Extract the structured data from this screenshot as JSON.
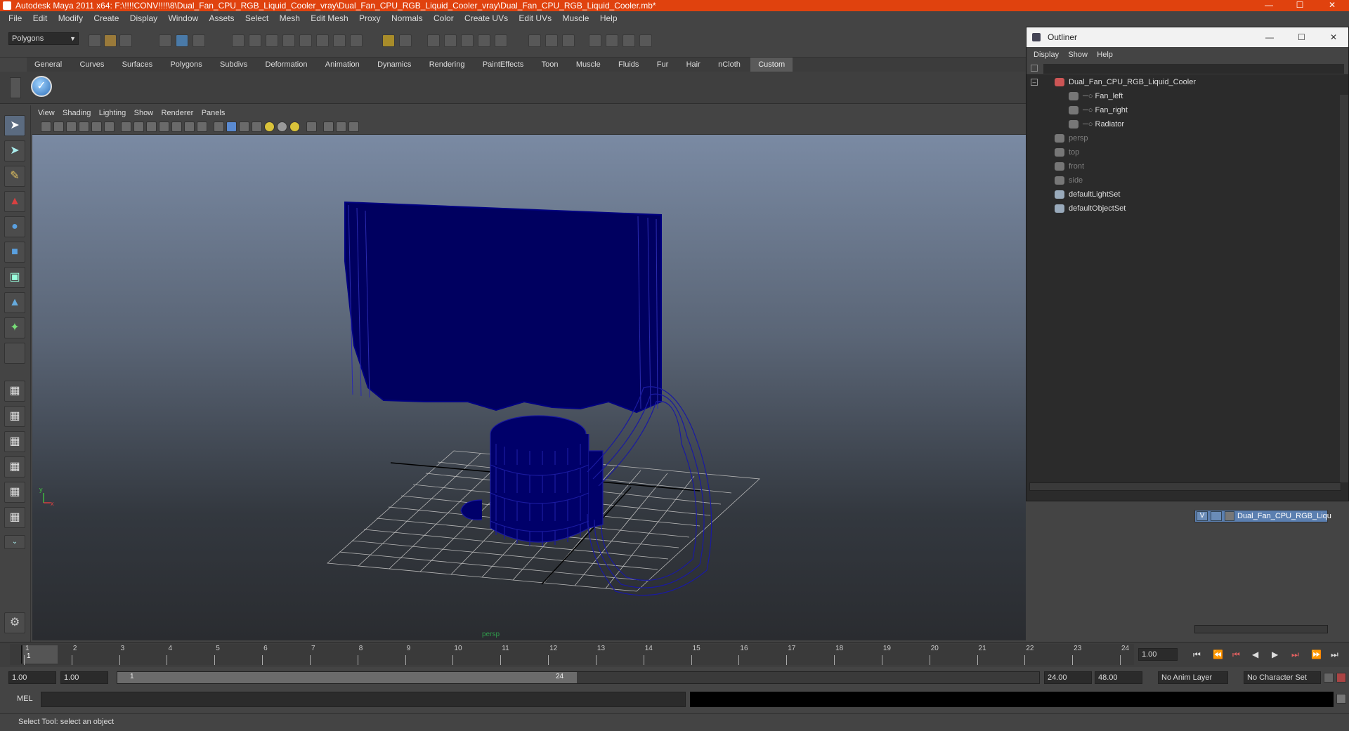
{
  "window": {
    "title": "Autodesk Maya 2011 x64: F:\\!!!!CONV!!!!\\8\\Dual_Fan_CPU_RGB_Liquid_Cooler_vray\\Dual_Fan_CPU_RGB_Liquid_Cooler_vray\\Dual_Fan_CPU_RGB_Liquid_Cooler.mb*"
  },
  "menubar": [
    "File",
    "Edit",
    "Modify",
    "Create",
    "Display",
    "Window",
    "Assets",
    "Select",
    "Mesh",
    "Edit Mesh",
    "Proxy",
    "Normals",
    "Color",
    "Create UVs",
    "Edit UVs",
    "Muscle",
    "Help"
  ],
  "statusline": {
    "mode_select": "Polygons"
  },
  "shelf": {
    "tabs": [
      "General",
      "Curves",
      "Surfaces",
      "Polygons",
      "Subdivs",
      "Deformation",
      "Animation",
      "Dynamics",
      "Rendering",
      "PaintEffects",
      "Toon",
      "Muscle",
      "Fluids",
      "Fur",
      "Hair",
      "nCloth",
      "Custom"
    ],
    "active_tab": "Custom"
  },
  "panel": {
    "menu": [
      "View",
      "Shading",
      "Lighting",
      "Show",
      "Renderer",
      "Panels"
    ],
    "camera_label": "persp"
  },
  "timeline": {
    "ticks": [
      "1",
      "2",
      "3",
      "4",
      "5",
      "6",
      "7",
      "8",
      "9",
      "10",
      "11",
      "12",
      "13",
      "14",
      "15",
      "16",
      "17",
      "18",
      "19",
      "20",
      "21",
      "22",
      "23",
      "24"
    ],
    "current_frame": "1",
    "current_time_field": "1.00"
  },
  "range": {
    "start": "1.00",
    "playback_start": "1.00",
    "slider_start": "1",
    "slider_end": "24",
    "playback_end": "24.00",
    "end": "48.00",
    "anim_layer": "No Anim Layer",
    "character_set": "No Character Set"
  },
  "command": {
    "label": "MEL"
  },
  "helpline": {
    "text": "Select Tool: select an object"
  },
  "outliner": {
    "title": "Outliner",
    "menu": [
      "Display",
      "Show",
      "Help"
    ],
    "items": [
      {
        "label": "Dual_Fan_CPU_RGB_Liquid_Cooler",
        "indent": 0,
        "dim": false,
        "icon": "transform-icon"
      },
      {
        "label": "Fan_left",
        "indent": 1,
        "dim": false,
        "icon": "mesh-icon"
      },
      {
        "label": "Fan_right",
        "indent": 1,
        "dim": false,
        "icon": "mesh-icon"
      },
      {
        "label": "Radiator",
        "indent": 1,
        "dim": false,
        "icon": "mesh-icon"
      },
      {
        "label": "persp",
        "indent": 0,
        "dim": true,
        "icon": "camera-icon"
      },
      {
        "label": "top",
        "indent": 0,
        "dim": true,
        "icon": "camera-icon"
      },
      {
        "label": "front",
        "indent": 0,
        "dim": true,
        "icon": "camera-icon"
      },
      {
        "label": "side",
        "indent": 0,
        "dim": true,
        "icon": "camera-icon"
      },
      {
        "label": "defaultLightSet",
        "indent": 0,
        "dim": false,
        "icon": "set-icon"
      },
      {
        "label": "defaultObjectSet",
        "indent": 0,
        "dim": false,
        "icon": "set-icon"
      }
    ]
  },
  "layers": {
    "row_visible": "V",
    "row_name": "Dual_Fan_CPU_RGB_Liqu"
  },
  "colors": {
    "title_bar": "#e0420e",
    "wireframe": "#000080",
    "grid": "#b8b8b8"
  }
}
